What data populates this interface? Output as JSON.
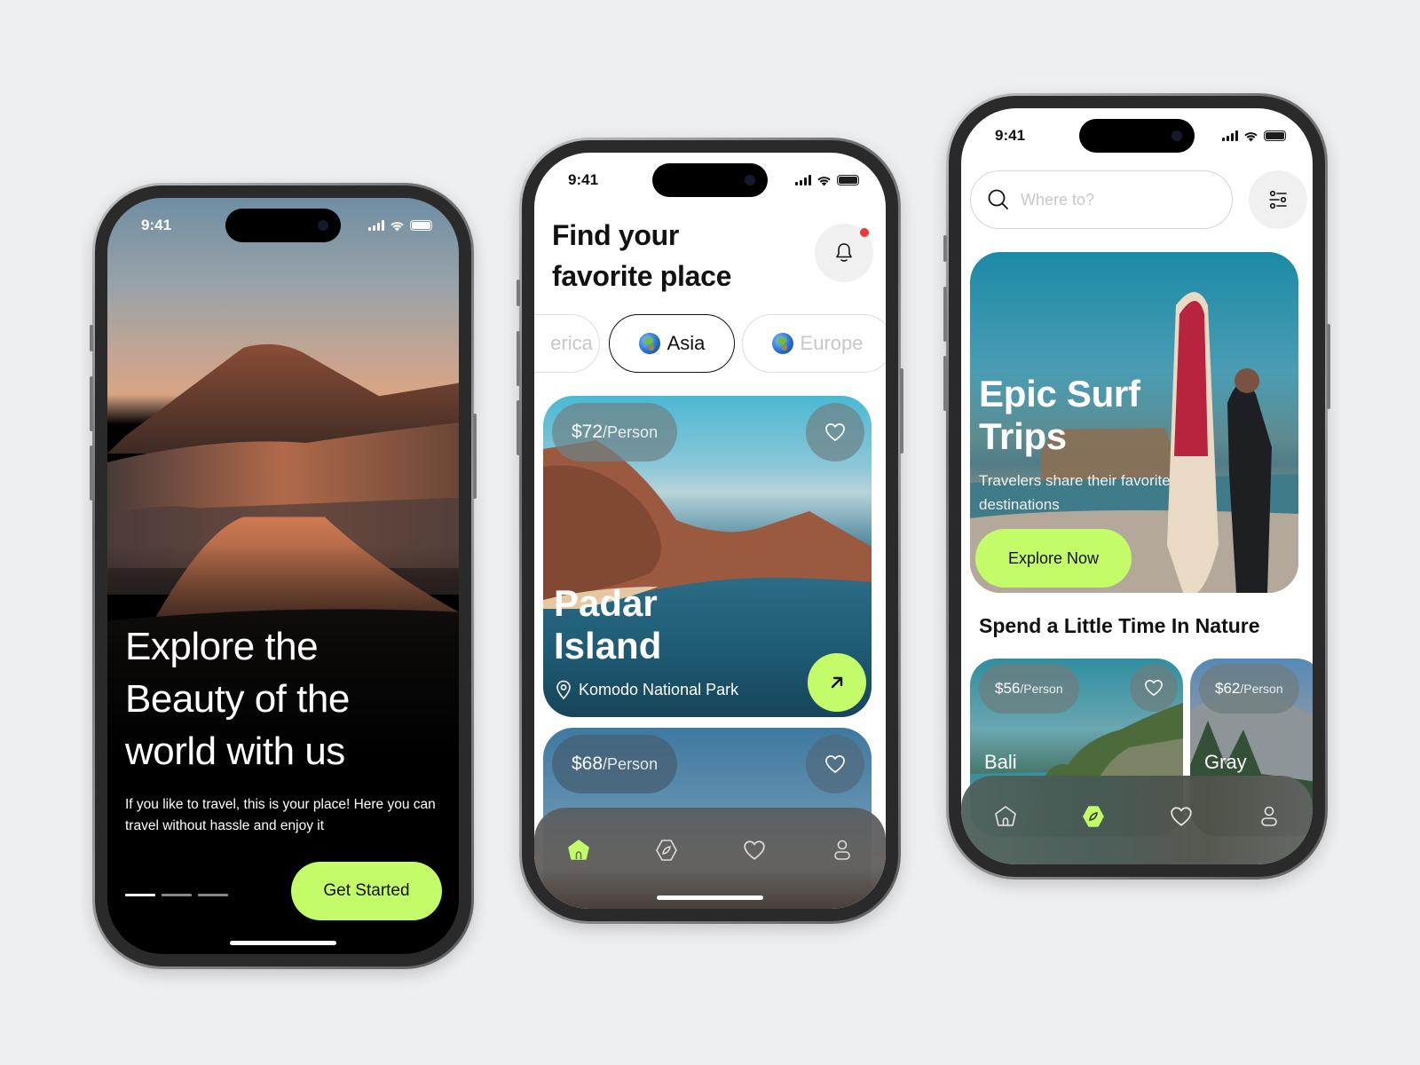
{
  "colors": {
    "background": "#eeeff1",
    "accent_green": "#c3fb69",
    "notification_dot": "#f0353c",
    "text_dark": "#111111"
  },
  "status_bar": {
    "time": "9:41",
    "icons": [
      "signal-icon",
      "wifi-icon",
      "battery-icon"
    ]
  },
  "onboarding": {
    "title": "Explore the Beauty of the world with us",
    "subtitle": "If you like to travel, this is your place! Here you can travel without hassle and enjoy it",
    "pagination": {
      "total": 3,
      "active": 1
    },
    "cta_label": "Get Started"
  },
  "home": {
    "title": "Find your favorite place",
    "notification_icon": "bell-icon",
    "has_notification": true,
    "regions": [
      {
        "label": "America",
        "visible_text": "erica",
        "active": false
      },
      {
        "label": "Asia",
        "active": true
      },
      {
        "label": "Europe",
        "active": false
      }
    ],
    "places": [
      {
        "price": "$72",
        "unit": "/Person",
        "name": "Padar Island",
        "location": "Komodo National Park"
      },
      {
        "price": "$68",
        "unit": "/Person"
      }
    ],
    "tabs": [
      {
        "name": "home",
        "icon": "home-icon",
        "active": true
      },
      {
        "name": "explore",
        "icon": "compass-icon",
        "active": false
      },
      {
        "name": "favorites",
        "icon": "heart-icon",
        "active": false
      },
      {
        "name": "profile",
        "icon": "user-icon",
        "active": false
      }
    ]
  },
  "explore": {
    "search_placeholder": "Where to?",
    "search_value": "",
    "filter_icon": "sliders-icon",
    "hero": {
      "title": "Epic Surf Trips",
      "subtitle": "Travelers share their favorite destinations",
      "cta_label": "Explore Now"
    },
    "section_title": "Spend a Little Time In Nature",
    "cards": [
      {
        "price": "$56",
        "unit": "/Person",
        "name": "Bali"
      },
      {
        "price": "$62",
        "unit": "/Person",
        "name": "Gray"
      }
    ],
    "tabs": [
      {
        "name": "home",
        "icon": "home-icon",
        "active": false
      },
      {
        "name": "explore",
        "icon": "compass-icon",
        "active": true
      },
      {
        "name": "favorites",
        "icon": "heart-icon",
        "active": false
      },
      {
        "name": "profile",
        "icon": "user-icon",
        "active": false
      }
    ]
  }
}
